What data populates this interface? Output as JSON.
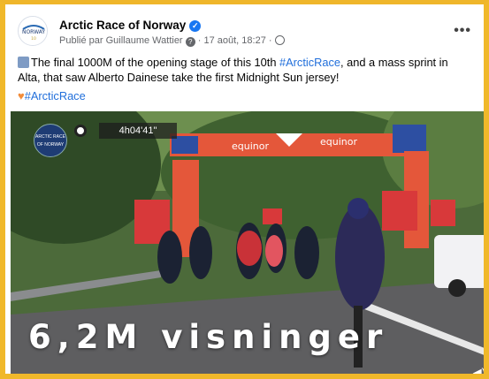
{
  "post": {
    "page_name": "Arctic Race of Norway",
    "verified": true,
    "meta": "Publié par Guillaume Wattier",
    "date": "17 août, 18:27",
    "more_label": "•••",
    "text_before": "The final 1000M of the opening stage of this 10th ",
    "hashtag_inline": "#ArcticRace",
    "text_after": ", and a mass sprint in Alta, that saw Alberto Dainese take the first Midnight Sun jersey!",
    "hashtag_line": "#ArcticRace"
  },
  "video": {
    "timer": "4h04'41\"",
    "views_overlay": "6,2M visninger",
    "logo_text": "ARCTIC RACE OF NORWAY",
    "banner_text": "equinor"
  },
  "colors": {
    "frame": "#f0b82a",
    "hashtag": "#216fdb",
    "banner": "#e4573a"
  }
}
